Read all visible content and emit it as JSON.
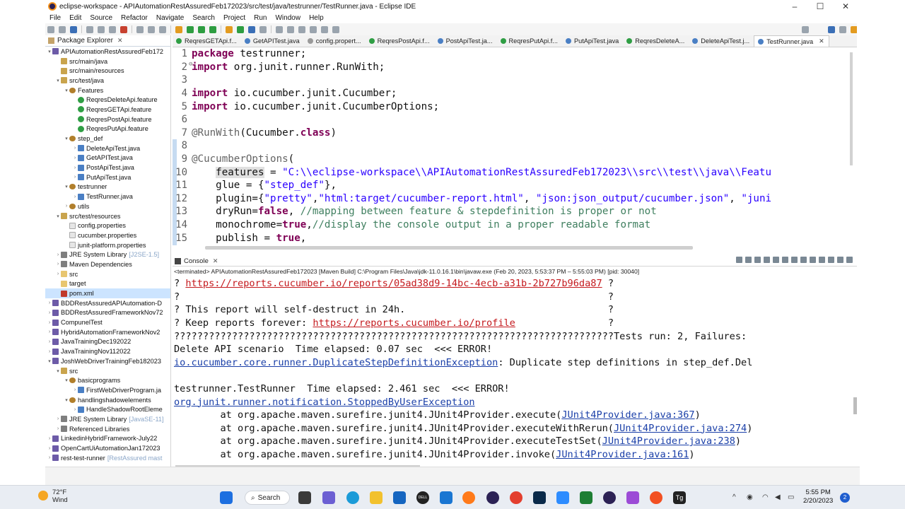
{
  "window": {
    "title": "eclipse-workspace - APIAutomationRestAssuredFeb172023/src/test/java/testrunner/TestRunner.java - Eclipse IDE",
    "controls": {
      "minimize": "–",
      "maximize": "☐",
      "close": "✕"
    }
  },
  "menu": [
    "File",
    "Edit",
    "Source",
    "Refactor",
    "Navigate",
    "Search",
    "Project",
    "Run",
    "Window",
    "Help"
  ],
  "package_explorer": {
    "title": "Package Explorer",
    "items": [
      {
        "label": "APIAutomationRestAssuredFeb172",
        "icon": "project",
        "depth": 0,
        "twisty": "▾"
      },
      {
        "label": "src/main/java",
        "icon": "package-folder",
        "depth": 1,
        "twisty": ""
      },
      {
        "label": "src/main/resources",
        "icon": "package-folder",
        "depth": 1,
        "twisty": ""
      },
      {
        "label": "src/test/java",
        "icon": "package-folder",
        "depth": 1,
        "twisty": "▾"
      },
      {
        "label": "Features",
        "icon": "package",
        "depth": 2,
        "twisty": "▾"
      },
      {
        "label": "ReqresDeleteApi.feature",
        "icon": "feature",
        "depth": 3,
        "twisty": ""
      },
      {
        "label": "ReqresGETApi.feature",
        "icon": "feature",
        "depth": 3,
        "twisty": ""
      },
      {
        "label": "ReqresPostApi.feature",
        "icon": "feature",
        "depth": 3,
        "twisty": ""
      },
      {
        "label": "ReqresPutApi.feature",
        "icon": "feature",
        "depth": 3,
        "twisty": ""
      },
      {
        "label": "step_def",
        "icon": "package",
        "depth": 2,
        "twisty": "▾"
      },
      {
        "label": "DeleteApiTest.java",
        "icon": "java",
        "depth": 3,
        "twisty": "›"
      },
      {
        "label": "GetAPITest.java",
        "icon": "java",
        "depth": 3,
        "twisty": "›"
      },
      {
        "label": "PostApiTest.java",
        "icon": "java",
        "depth": 3,
        "twisty": "›"
      },
      {
        "label": "PutApiTest.java",
        "icon": "java",
        "depth": 3,
        "twisty": "›"
      },
      {
        "label": "testrunner",
        "icon": "package",
        "depth": 2,
        "twisty": "▾"
      },
      {
        "label": "TestRunner.java",
        "icon": "java",
        "depth": 3,
        "twisty": "›"
      },
      {
        "label": "utils",
        "icon": "package",
        "depth": 2,
        "twisty": "›"
      },
      {
        "label": "src/test/resources",
        "icon": "package-folder",
        "depth": 1,
        "twisty": "▾"
      },
      {
        "label": "config.properties",
        "icon": "file",
        "depth": 2,
        "twisty": ""
      },
      {
        "label": "cucumber.properties",
        "icon": "file",
        "depth": 2,
        "twisty": ""
      },
      {
        "label": "junit-platform.properties",
        "icon": "file",
        "depth": 2,
        "twisty": ""
      },
      {
        "label": "JRE System Library",
        "icon": "library",
        "depth": 1,
        "twisty": "›",
        "decoration": "[J2SE-1.5]"
      },
      {
        "label": "Maven Dependencies",
        "icon": "library",
        "depth": 1,
        "twisty": "›"
      },
      {
        "label": "src",
        "icon": "folder",
        "depth": 1,
        "twisty": "›"
      },
      {
        "label": "target",
        "icon": "folder",
        "depth": 1,
        "twisty": ""
      },
      {
        "label": "pom.xml",
        "icon": "xml",
        "depth": 1,
        "twisty": "",
        "selected": true
      },
      {
        "label": "BDDRestAssuredAPIAutomation-D",
        "icon": "project",
        "depth": 0,
        "twisty": "›"
      },
      {
        "label": "BDDRestAssuredFrameworkNov72",
        "icon": "project",
        "depth": 0,
        "twisty": "›"
      },
      {
        "label": "CompunelTest",
        "icon": "project",
        "depth": 0,
        "twisty": "›"
      },
      {
        "label": "HybridAutomationFrameworkNov2",
        "icon": "project",
        "depth": 0,
        "twisty": "›"
      },
      {
        "label": "JavaTrainingDec192022",
        "icon": "project",
        "depth": 0,
        "twisty": "›"
      },
      {
        "label": "JavaTrainingNov112022",
        "icon": "project",
        "depth": 0,
        "twisty": "›"
      },
      {
        "label": "JoshWebDriverTrainingFeb182023",
        "icon": "project",
        "depth": 0,
        "twisty": "▾"
      },
      {
        "label": "src",
        "icon": "package-folder",
        "depth": 1,
        "twisty": "▾"
      },
      {
        "label": "basicprograms",
        "icon": "package",
        "depth": 2,
        "twisty": "▾"
      },
      {
        "label": "FirstWebDriverProgram.ja",
        "icon": "java",
        "depth": 3,
        "twisty": "›"
      },
      {
        "label": "handlingshadowelements",
        "icon": "package",
        "depth": 2,
        "twisty": "▾"
      },
      {
        "label": "HandleShadowRootEleme",
        "icon": "java",
        "depth": 3,
        "twisty": "›"
      },
      {
        "label": "JRE System Library",
        "icon": "library",
        "depth": 1,
        "twisty": "›",
        "decoration": "[JavaSE-11]"
      },
      {
        "label": "Referenced Libraries",
        "icon": "library",
        "depth": 1,
        "twisty": "›"
      },
      {
        "label": "LinkedinHybridFramework-July22",
        "icon": "project",
        "depth": 0,
        "twisty": "›"
      },
      {
        "label": "OpenCartUiAutomationJan172023",
        "icon": "project",
        "depth": 0,
        "twisty": "›"
      },
      {
        "label": "rest-test-runner",
        "icon": "project",
        "depth": 0,
        "twisty": "›",
        "decoration": "[RestAssured mast"
      }
    ]
  },
  "editor": {
    "tabs": [
      {
        "label": "ReqresGETApi.f...",
        "icon": "feature"
      },
      {
        "label": "GetAPITest.java",
        "icon": "java"
      },
      {
        "label": "config.propert...",
        "icon": "file"
      },
      {
        "label": "ReqresPostApi.f...",
        "icon": "feature"
      },
      {
        "label": "PostApiTest.ja...",
        "icon": "java"
      },
      {
        "label": "ReqresPutApi.f...",
        "icon": "feature"
      },
      {
        "label": "PutApiTest.java",
        "icon": "java"
      },
      {
        "label": "ReqresDeleteA...",
        "icon": "feature"
      },
      {
        "label": "DeleteApiTest.j...",
        "icon": "java"
      },
      {
        "label": "TestRunner.java",
        "icon": "java",
        "active": true,
        "close": "✕"
      }
    ],
    "lines": [
      {
        "n": "1",
        "parts": [
          [
            "kw",
            "package"
          ],
          [
            "tx",
            " testrunner;"
          ]
        ]
      },
      {
        "n": "2",
        "fold": "⊖",
        "parts": [
          [
            "kw",
            "import"
          ],
          [
            "tx",
            " org.junit.runner.RunWith;"
          ]
        ]
      },
      {
        "n": "3",
        "parts": []
      },
      {
        "n": "4",
        "parts": [
          [
            "kw",
            "import"
          ],
          [
            "tx",
            " io.cucumber.junit.Cucumber;"
          ]
        ]
      },
      {
        "n": "5",
        "parts": [
          [
            "kw",
            "import"
          ],
          [
            "tx",
            " io.cucumber.junit.CucumberOptions;"
          ]
        ]
      },
      {
        "n": "6",
        "parts": []
      },
      {
        "n": "7",
        "parts": [
          [
            "ann",
            "@RunWith"
          ],
          [
            "tx",
            "(Cucumber."
          ],
          [
            "kw",
            "class"
          ],
          [
            "tx",
            ")"
          ]
        ]
      },
      {
        "n": "8",
        "parts": []
      },
      {
        "n": "9",
        "parts": [
          [
            "ann",
            "@CucumberOptions"
          ],
          [
            "tx",
            "("
          ]
        ]
      },
      {
        "n": "10",
        "parts": [
          [
            "tx",
            "    "
          ],
          [
            "hl",
            "features"
          ],
          [
            "tx",
            " = "
          ],
          [
            "str",
            "\"C:\\\\eclipse-workspace\\\\APIAutomationRestAssuredFeb172023\\\\src\\\\test\\\\java\\\\Featu"
          ]
        ]
      },
      {
        "n": "11",
        "parts": [
          [
            "tx",
            "    glue = {"
          ],
          [
            "str",
            "\"step_def\""
          ],
          [
            "tx",
            "},"
          ]
        ]
      },
      {
        "n": "12",
        "parts": [
          [
            "tx",
            "    plugin={"
          ],
          [
            "str",
            "\"pretty\""
          ],
          [
            "tx",
            ","
          ],
          [
            "str",
            "\"html:target/cucumber-report.html\""
          ],
          [
            "tx",
            ", "
          ],
          [
            "str",
            "\"json:json_output/cucumber.json\""
          ],
          [
            "tx",
            ", "
          ],
          [
            "str",
            "\"juni"
          ]
        ]
      },
      {
        "n": "13",
        "parts": [
          [
            "tx",
            "    dryRun="
          ],
          [
            "kw",
            "false"
          ],
          [
            "tx",
            ", "
          ],
          [
            "cm",
            "//mapping between feature & stepdefinition is proper or not"
          ]
        ]
      },
      {
        "n": "14",
        "parts": [
          [
            "tx",
            "    monochrome="
          ],
          [
            "kw",
            "true"
          ],
          [
            "tx",
            ","
          ],
          [
            "cm",
            "//display the console output in a proper readable format"
          ]
        ]
      },
      {
        "n": "15",
        "parts": [
          [
            "tx",
            "    publish = "
          ],
          [
            "kw",
            "true"
          ],
          [
            "tx",
            ","
          ]
        ]
      }
    ]
  },
  "console": {
    "title": "Console",
    "terminated": "<terminated> APIAutomationRestAssuredFeb172023 [Maven Build] C:\\Program Files\\Java\\jdk-11.0.16.1\\bin\\javaw.exe  (Feb 20, 2023, 5:53:37 PM – 5:55:03 PM) [pid: 30040]",
    "lines": [
      {
        "parts": [
          [
            "red",
            "? "
          ],
          [
            "redlink",
            "https://reports.cucumber.io/reports/05ad38d9-14bc-4ecb-a31b-2b727b96da87"
          ],
          [
            "red",
            " ?"
          ]
        ]
      },
      {
        "parts": [
          [
            "red",
            "?                                                                          ?"
          ]
        ]
      },
      {
        "parts": [
          [
            "red",
            "? This report will self-destruct in 24h.                                   ?"
          ]
        ]
      },
      {
        "parts": [
          [
            "red",
            "? Keep reports forever: "
          ],
          [
            "redlink",
            "https://reports.cucumber.io/profile"
          ],
          [
            "red",
            "                ?"
          ]
        ]
      },
      {
        "parts": [
          [
            "red",
            "????????????????????????????????????????????????????????????????????????????"
          ],
          [
            "tx",
            "Tests run: 2, Failures:"
          ]
        ]
      },
      {
        "parts": [
          [
            "tx",
            "Delete API scenario  Time elapsed: 0.07 sec  <<< ERROR!"
          ]
        ]
      },
      {
        "parts": [
          [
            "link",
            "io.cucumber.core.runner.DuplicateStepDefinitionException"
          ],
          [
            "tx",
            ": Duplicate step definitions in step_def.Del"
          ]
        ]
      },
      {
        "parts": []
      },
      {
        "parts": [
          [
            "tx",
            "testrunner.TestRunner  Time elapsed: 2.461 sec  <<< ERROR!"
          ]
        ]
      },
      {
        "parts": [
          [
            "link",
            "org.junit.runner.notification.StoppedByUserException"
          ]
        ]
      },
      {
        "parts": [
          [
            "tx",
            "        at org.apache.maven.surefire.junit4.JUnit4Provider.execute("
          ],
          [
            "link",
            "JUnit4Provider.java:367"
          ],
          [
            "tx",
            ")"
          ]
        ]
      },
      {
        "parts": [
          [
            "tx",
            "        at org.apache.maven.surefire.junit4.JUnit4Provider.executeWithRerun("
          ],
          [
            "link",
            "JUnit4Provider.java:274"
          ],
          [
            "tx",
            ")"
          ]
        ]
      },
      {
        "parts": [
          [
            "tx",
            "        at org.apache.maven.surefire.junit4.JUnit4Provider.executeTestSet("
          ],
          [
            "link",
            "JUnit4Provider.java:238"
          ],
          [
            "tx",
            ")"
          ]
        ]
      },
      {
        "parts": [
          [
            "tx",
            "        at org.apache.maven.surefire.junit4.JUnit4Provider.invoke("
          ],
          [
            "link",
            "JUnit4Provider.java:161"
          ],
          [
            "tx",
            ")"
          ]
        ]
      }
    ]
  },
  "taskbar": {
    "weather_temp": "72°F",
    "weather_desc": "Wind",
    "search_label": "Search",
    "tb_dell": "DELL",
    "tb_tg": "Tg",
    "time": "5:55 PM",
    "date": "2/20/2023",
    "notification_count": "2"
  },
  "colors": {
    "keyword": "#7f0055",
    "string": "#2a00ff",
    "comment": "#3f7f5f",
    "error": "#c4191d",
    "link": "#1a3fa8"
  }
}
